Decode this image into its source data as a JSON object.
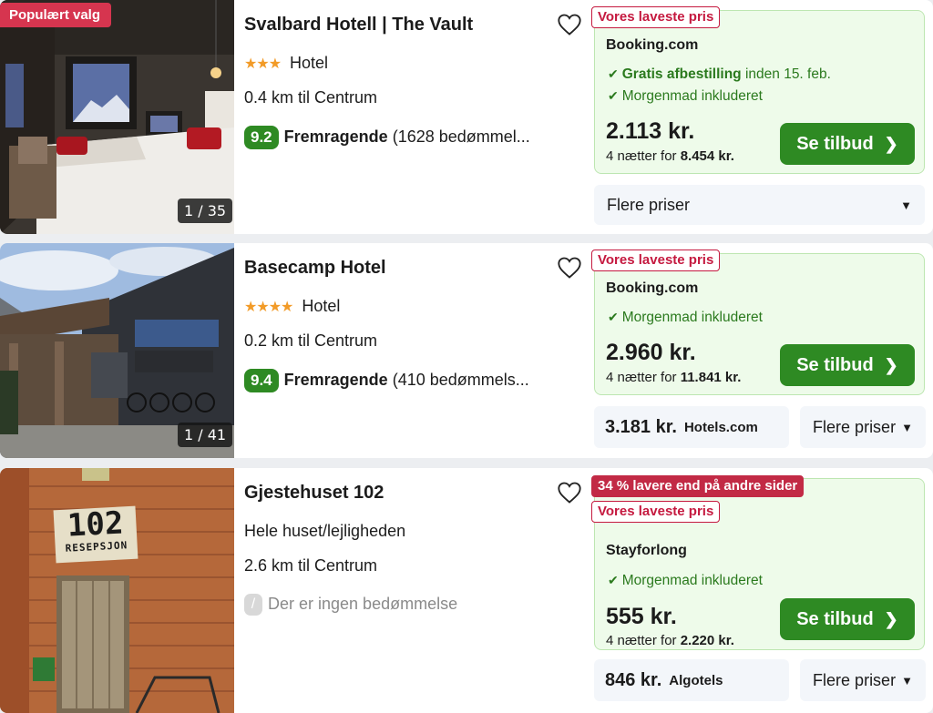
{
  "listings": [
    {
      "badge": "Populært valg",
      "photo_counter": "1 / 35",
      "name": "Svalbard Hotell | The Vault",
      "stars": "★★★",
      "type": "Hotel",
      "distance": "0.4 km til Centrum",
      "score": "9.2",
      "rating_word": "Fremragende",
      "reviews": "(1628 bedømmel...",
      "tag": "Vores laveste pris",
      "provider": "Booking.com",
      "perk1_bold": "Gratis afbestilling",
      "perk1_rest": " inden 15. feb.",
      "perk2": "Morgenmad inkluderet",
      "price": "2.113 kr.",
      "nights_prefix": "4 nætter for ",
      "nights_total": "8.454 kr.",
      "cta": "Se tilbud",
      "more_prices": "Flere priser"
    },
    {
      "photo_counter": "1 / 41",
      "name": "Basecamp Hotel",
      "stars": "★★★★",
      "type": "Hotel",
      "distance": "0.2 km til Centrum",
      "score": "9.4",
      "rating_word": "Fremragende",
      "reviews": "(410 bedømmels...",
      "tag": "Vores laveste pris",
      "provider": "Booking.com",
      "perk1": "Morgenmad inkluderet",
      "price": "2.960 kr.",
      "nights_prefix": "4 nætter for ",
      "nights_total": "11.841 kr.",
      "cta": "Se tilbud",
      "alt_price": "3.181 kr.",
      "alt_site": "Hotels.com",
      "more_prices": "Flere priser"
    },
    {
      "name": "Gjestehuset 102",
      "type": "Hele huset/lejligheden",
      "distance": "2.6 km til Centrum",
      "no_rating": "Der er ingen bedømmelse",
      "tag_discount": "34 % lavere end på andre sider",
      "tag": "Vores laveste pris",
      "provider": "Stayforlong",
      "perk1": "Morgenmad inkluderet",
      "price": "555 kr.",
      "nights_prefix": "4 nætter for ",
      "nights_total": "2.220 kr.",
      "cta": "Se tilbud",
      "alt_price": "846 kr.",
      "alt_site": "Algotels",
      "more_prices": "Flere priser",
      "sign_text": "102",
      "sign_subtext": "RESEPSJON"
    }
  ],
  "colors": {
    "accent_green": "#2e8a23",
    "deal_bg": "#eefbea",
    "tag_red": "#c5193f",
    "popular_pink": "#d6354f",
    "stars": "#f29b28"
  },
  "icons": [
    "heart-icon",
    "check-icon",
    "chevron-right-icon",
    "chevron-down-icon"
  ]
}
